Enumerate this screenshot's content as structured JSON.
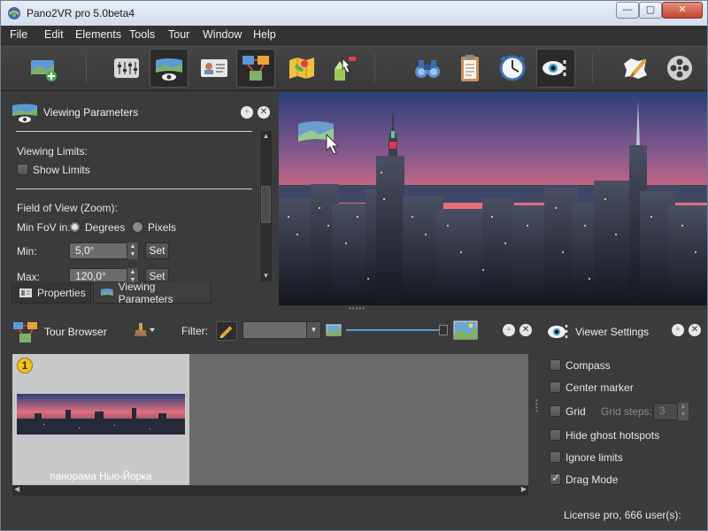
{
  "window": {
    "title": "Pano2VR pro 5.0beta4",
    "controls": {
      "minimize": "—",
      "maximize": "▢",
      "close": "✕"
    }
  },
  "menu": [
    "File",
    "Edit",
    "Elements",
    "Tools",
    "Tour",
    "Window",
    "Help"
  ],
  "toolbar": {
    "icons": [
      "add-panorama-icon",
      "sliders-icon",
      "viewing-parameters-icon",
      "properties-card-icon",
      "tour-browser-icon",
      "map-icon",
      "hotspot-icon",
      "binoculars-icon",
      "clipboard-icon",
      "animation-clock-icon",
      "viewer-settings-icon",
      "user-data-icon",
      "film-reel-icon"
    ]
  },
  "viewing_parameters": {
    "title": "Viewing Parameters",
    "viewing_limits_label": "Viewing Limits:",
    "show_limits_label": "Show Limits",
    "show_limits_checked": false,
    "fov_label": "Field of View (Zoom):",
    "min_fov_in_label": "Min FoV in:",
    "degrees_label": "Degrees",
    "pixels_label": "Pixels",
    "unit_selected": "Degrees",
    "min_label": "Min:",
    "min_value": "5,0°",
    "max_label": "Max:",
    "max_value": "120,0°",
    "set_label": "Set"
  },
  "tabs": [
    {
      "label": "Properties",
      "active": false
    },
    {
      "label": "Viewing Parameters",
      "active": true
    }
  ],
  "tour_browser": {
    "title": "Tour Browser",
    "filter_label": "Filter:",
    "filter_value": "",
    "node_number": "1",
    "node_caption": "панорама Нью-Йорка",
    "thumb_slider": 0.98
  },
  "viewer_settings": {
    "title": "Viewer Settings",
    "options": [
      {
        "label": "Compass",
        "checked": false
      },
      {
        "label": "Center marker",
        "checked": false
      },
      {
        "label": "Grid",
        "checked": false
      },
      {
        "label": "Hide ghost hotspots",
        "checked": false
      },
      {
        "label": "Ignore limits",
        "checked": false
      },
      {
        "label": "Drag Mode",
        "checked": true
      }
    ],
    "grid_steps_label": "Grid steps:",
    "grid_steps_value": "3",
    "license_text": "License pro, 666 user(s):"
  },
  "colors": {
    "panel_bg": "#3b3b3b",
    "toolbar_bg": "#404040",
    "accent_blue": "#5b9bd5",
    "sky_top": "#2a3f78",
    "sky_horizon": "#f0707a"
  }
}
